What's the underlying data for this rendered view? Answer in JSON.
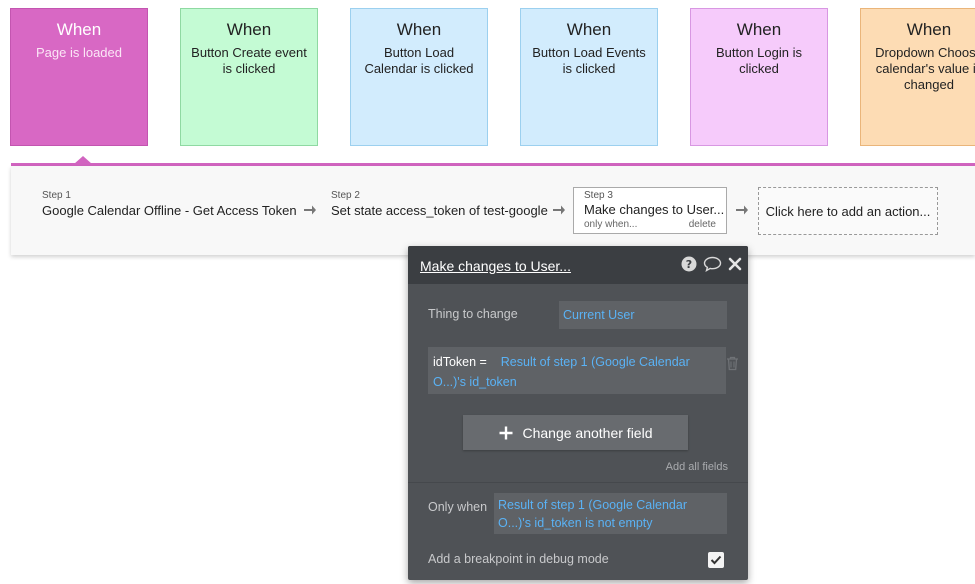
{
  "events": [
    {
      "when": "When",
      "desc": "Page is loaded",
      "color": "#d868c4"
    },
    {
      "when": "When",
      "desc": "Button Create event is clicked",
      "color": "#c4fbd4"
    },
    {
      "when": "When",
      "desc": "Button Load Calendar is clicked",
      "color": "#d2ecfd"
    },
    {
      "when": "When",
      "desc": "Button Load Events is clicked",
      "color": "#d2ecfd"
    },
    {
      "when": "When",
      "desc": "Button Login is clicked",
      "color": "#f6cbfb"
    },
    {
      "when": "When",
      "desc": "Dropdown Choose calendar's value is changed",
      "color": "#fddcb4"
    }
  ],
  "steps": [
    {
      "num": "Step 1",
      "title": "Google Calendar Offline - Get Access Token"
    },
    {
      "num": "Step 2",
      "title": "Set state access_token of test-google"
    },
    {
      "num": "Step 3",
      "title": "Make changes to User...",
      "only_when": "only when...",
      "delete": "delete"
    }
  ],
  "add_action": "Click here to add an action...",
  "panel": {
    "title": "Make changes to User...",
    "thing_label": "Thing to change",
    "thing_value": "Current User",
    "field_key": "idToken  =",
    "field_value": "Result of step 1 (Google Calendar O...)'s id_token",
    "change_button": "Change another field",
    "add_all": "Add all fields",
    "only_when_label": "Only when",
    "only_when_value": "Result of step 1 (Google Calendar O...)'s id_token is not empty",
    "breakpoint_label": "Add a breakpoint in debug mode",
    "breakpoint_checked": true
  },
  "icons": {
    "help": "help-icon",
    "comment": "comment-icon",
    "close": "close-icon",
    "trash": "trash-icon",
    "plus": "plus-icon",
    "arrow": "arrow-right-icon",
    "check": "check-icon"
  },
  "colors": {
    "accent_pink": "#d164c0",
    "link_blue": "#5ab2f5",
    "panel_bg": "#4f5256"
  }
}
